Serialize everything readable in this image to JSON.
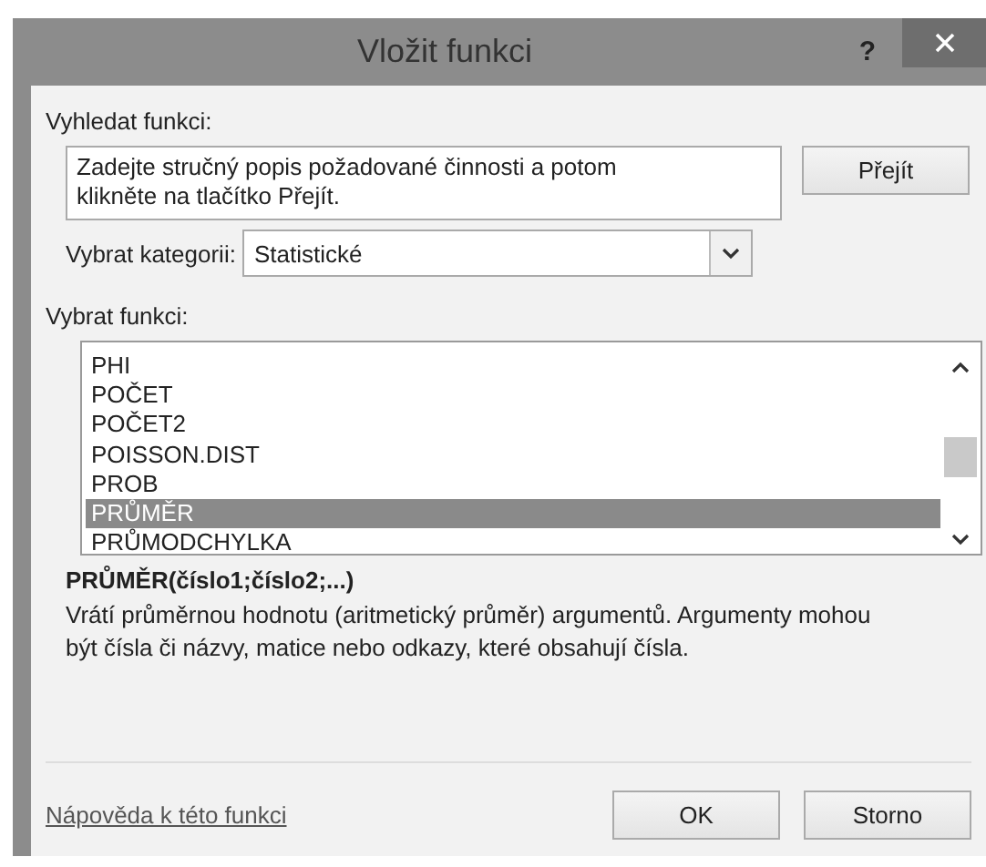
{
  "window": {
    "title": "Vložit funkci",
    "help": "?"
  },
  "search": {
    "label": "Vyhledat funkci:",
    "value": "Zadejte stručný popis požadované činnosti a potom klikněte na tlačítko Přejít.",
    "button": "Přejít"
  },
  "category": {
    "label": "Vybrat kategorii:",
    "value": "Statistické"
  },
  "functions": {
    "label": "Vybrat funkci:",
    "items": [
      {
        "name": "PHI",
        "selected": false
      },
      {
        "name": "POČET",
        "selected": false
      },
      {
        "name": "POČET2",
        "selected": false
      },
      {
        "name": "POISSON.DIST",
        "selected": false
      },
      {
        "name": "PROB",
        "selected": false
      },
      {
        "name": "PRŮMĚR",
        "selected": true
      },
      {
        "name": "PRŮMODCHYLKA",
        "selected": false
      }
    ]
  },
  "signature": "PRŮMĚR(číslo1;číslo2;...)",
  "description": "Vrátí průměrnou hodnotu (aritmetický průměr) argumentů. Argumenty mohou být čísla či názvy, matice nebo odkazy, které obsahují čísla.",
  "help_link": "Nápověda k této funkci",
  "buttons": [
    "OK",
    "Storno"
  ]
}
